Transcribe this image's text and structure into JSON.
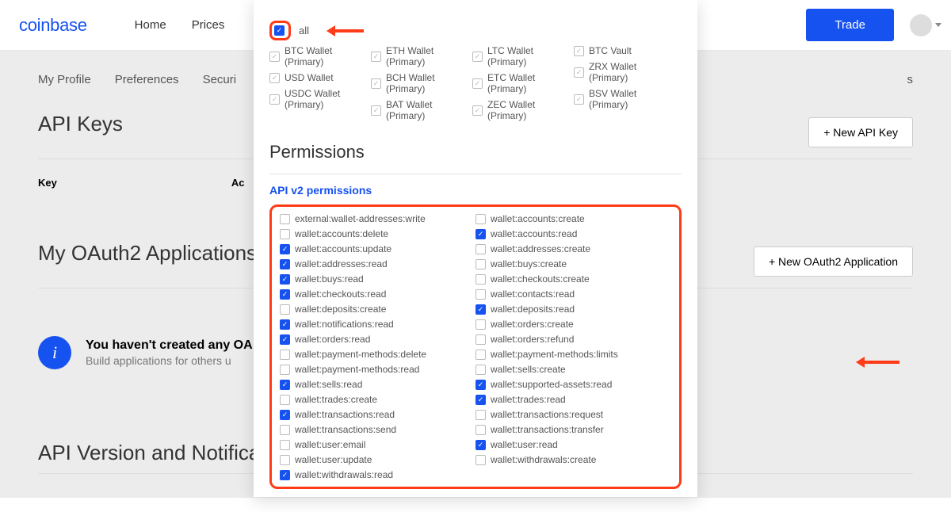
{
  "header": {
    "logo": "coinbase",
    "nav": {
      "home": "Home",
      "prices": "Prices"
    },
    "trade": "Trade"
  },
  "tabs": {
    "profile": "My Profile",
    "preferences": "Preferences",
    "security": "Securi"
  },
  "sections": {
    "api_keys": {
      "title": "API Keys",
      "new_btn": "+  New API Key",
      "th_key": "Key",
      "th_ac": "Ac",
      "truncated_s": "s"
    },
    "oauth": {
      "title": "My OAuth2 Applications",
      "new_btn": "+  New OAuth2 Application",
      "info_title": "You haven't created any OA",
      "info_sub": "Build applications for others u"
    },
    "api_ver": {
      "title": "API Version and Notifications"
    }
  },
  "modal": {
    "all_label": "all",
    "wallets": [
      [
        "BTC Wallet (Primary)",
        "ETH Wallet (Primary)",
        "LTC Wallet (Primary)",
        "BTC Vault"
      ],
      [
        "USD Wallet",
        "BCH Wallet (Primary)",
        "ETC Wallet (Primary)",
        "ZRX Wallet (Primary)"
      ],
      [
        "USDC Wallet (Primary)",
        "BAT Wallet (Primary)",
        "ZEC Wallet (Primary)",
        "BSV Wallet (Primary)"
      ]
    ],
    "perm_heading": "Permissions",
    "perm_sub": "API v2 permissions",
    "permissions": {
      "left": [
        {
          "l": "external:wallet-addresses:write",
          "c": false
        },
        {
          "l": "wallet:accounts:delete",
          "c": false
        },
        {
          "l": "wallet:accounts:update",
          "c": true
        },
        {
          "l": "wallet:addresses:read",
          "c": true
        },
        {
          "l": "wallet:buys:read",
          "c": true
        },
        {
          "l": "wallet:checkouts:read",
          "c": true
        },
        {
          "l": "wallet:deposits:create",
          "c": false
        },
        {
          "l": "wallet:notifications:read",
          "c": true
        },
        {
          "l": "wallet:orders:read",
          "c": true
        },
        {
          "l": "wallet:payment-methods:delete",
          "c": false
        },
        {
          "l": "wallet:payment-methods:read",
          "c": false
        },
        {
          "l": "wallet:sells:read",
          "c": true
        },
        {
          "l": "wallet:trades:create",
          "c": false
        },
        {
          "l": "wallet:transactions:read",
          "c": true
        },
        {
          "l": "wallet:transactions:send",
          "c": false
        },
        {
          "l": "wallet:user:email",
          "c": false
        },
        {
          "l": "wallet:user:update",
          "c": false
        },
        {
          "l": "wallet:withdrawals:read",
          "c": true
        }
      ],
      "right": [
        {
          "l": "wallet:accounts:create",
          "c": false
        },
        {
          "l": "wallet:accounts:read",
          "c": true
        },
        {
          "l": "wallet:addresses:create",
          "c": false
        },
        {
          "l": "wallet:buys:create",
          "c": false
        },
        {
          "l": "wallet:checkouts:create",
          "c": false
        },
        {
          "l": "wallet:contacts:read",
          "c": false
        },
        {
          "l": "wallet:deposits:read",
          "c": true
        },
        {
          "l": "wallet:orders:create",
          "c": false
        },
        {
          "l": "wallet:orders:refund",
          "c": false
        },
        {
          "l": "wallet:payment-methods:limits",
          "c": false
        },
        {
          "l": "wallet:sells:create",
          "c": false
        },
        {
          "l": "wallet:supported-assets:read",
          "c": true
        },
        {
          "l": "wallet:trades:read",
          "c": true
        },
        {
          "l": "wallet:transactions:request",
          "c": false
        },
        {
          "l": "wallet:transactions:transfer",
          "c": false
        },
        {
          "l": "wallet:user:read",
          "c": true
        },
        {
          "l": "wallet:withdrawals:create",
          "c": false
        }
      ]
    }
  }
}
